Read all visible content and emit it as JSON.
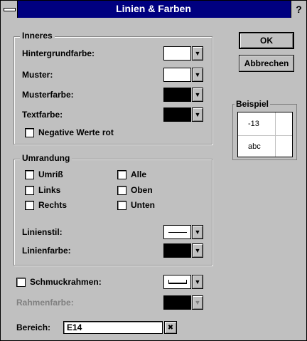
{
  "window": {
    "title": "Linien & Farben",
    "help_label": "?"
  },
  "buttons": {
    "ok": "OK",
    "cancel": "Abbrechen"
  },
  "interior": {
    "title": "Inneres",
    "background_label": "Hintergrundfarbe:",
    "pattern_label": "Muster:",
    "pattern_color_label": "Musterfarbe:",
    "text_color_label": "Textfarbe:",
    "negative_red_label": "Negative Werte rot",
    "background_color": "#ffffff",
    "pattern_color": "#ffffff",
    "pattern_fg_color": "#000000",
    "text_color": "#000000"
  },
  "border": {
    "title": "Umrandung",
    "options": {
      "outline": "Umriß",
      "left": "Links",
      "right": "Rechts",
      "all": "Alle",
      "top": "Oben",
      "bottom": "Unten"
    },
    "line_style_label": "Linienstil:",
    "line_color_label": "Linienfarbe:",
    "line_color": "#000000"
  },
  "frame": {
    "decorative_label": "Schmuckrahmen:",
    "frame_color_label": "Rahmenfarbe:",
    "frame_color": "#000000"
  },
  "sample": {
    "title": "Beispiel",
    "cell1": "-13",
    "cell2": "abc"
  },
  "range": {
    "label": "Bereich:",
    "value": "E14",
    "picker_icon": "range-picker-icon"
  },
  "dropdown_icon": "arrow-down-icon"
}
